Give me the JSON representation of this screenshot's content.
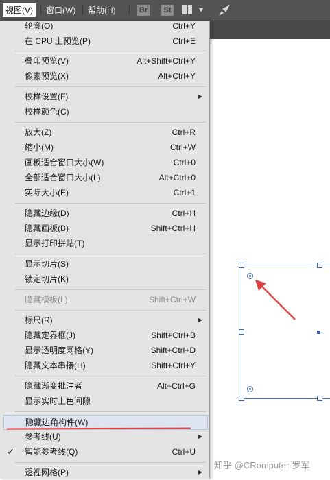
{
  "menubar": {
    "items": [
      {
        "label": "视图(V)",
        "active": true
      },
      {
        "label": "窗口(W)",
        "active": false
      },
      {
        "label": "帮助(H)",
        "active": false
      }
    ],
    "bridge_badge": "Br",
    "stock_badge": "St",
    "icons": {
      "workspace": "grid-layout-icon",
      "dropdown": "chevron-down-icon",
      "feedback": "rocket-icon"
    }
  },
  "menu": {
    "items": [
      {
        "label": "轮廓(O)",
        "shortcut": "Ctrl+Y"
      },
      {
        "label": "在 CPU 上预览(P)",
        "shortcut": "Ctrl+E"
      },
      {
        "label": "叠印预览(V)",
        "shortcut": "Alt+Shift+Ctrl+Y"
      },
      {
        "label": "像素预览(X)",
        "shortcut": "Alt+Ctrl+Y"
      },
      {
        "label": "校样设置(F)",
        "shortcut": ""
      },
      {
        "label": "校样颜色(C)",
        "shortcut": ""
      },
      {
        "label": "放大(Z)",
        "shortcut": "Ctrl+R"
      },
      {
        "label": "缩小(M)",
        "shortcut": "Ctrl+W"
      },
      {
        "label": "画板适合窗口大小(W)",
        "shortcut": "Ctrl+0"
      },
      {
        "label": "全部适合窗口大小(L)",
        "shortcut": "Alt+Ctrl+0"
      },
      {
        "label": "实际大小(E)",
        "shortcut": "Ctrl+1"
      },
      {
        "label": "隐藏边缘(D)",
        "shortcut": "Ctrl+H"
      },
      {
        "label": "隐藏画板(B)",
        "shortcut": "Shift+Ctrl+H"
      },
      {
        "label": "显示打印拼贴(T)",
        "shortcut": ""
      },
      {
        "label": "显示切片(S)",
        "shortcut": ""
      },
      {
        "label": "锁定切片(K)",
        "shortcut": ""
      },
      {
        "label": "隐藏模板(L)",
        "shortcut": "Shift+Ctrl+W"
      },
      {
        "label": "标尺(R)",
        "shortcut": ""
      },
      {
        "label": "隐藏定界框(J)",
        "shortcut": "Shift+Ctrl+B"
      },
      {
        "label": "显示透明度网格(Y)",
        "shortcut": "Shift+Ctrl+D"
      },
      {
        "label": "隐藏文本串接(H)",
        "shortcut": "Shift+Ctrl+Y"
      },
      {
        "label": "隐藏渐变批注者",
        "shortcut": "Alt+Ctrl+G"
      },
      {
        "label": "显示实时上色间隙",
        "shortcut": ""
      },
      {
        "label": "隐藏边角构件(W)",
        "shortcut": ""
      },
      {
        "label": "参考线(U)",
        "shortcut": ""
      },
      {
        "label": "智能参考线(Q)",
        "shortcut": "Ctrl+U"
      },
      {
        "label": "透视网格(P)",
        "shortcut": ""
      }
    ],
    "check_mark": "✓"
  },
  "watermark": "知乎 @CRomputer-罗军",
  "colors": {
    "menubar": "#535353",
    "menu_bg": "#e4e4e4",
    "highlight": "#dde3ef",
    "selection": "#3d64b0",
    "annotation_red": "#e04545"
  }
}
